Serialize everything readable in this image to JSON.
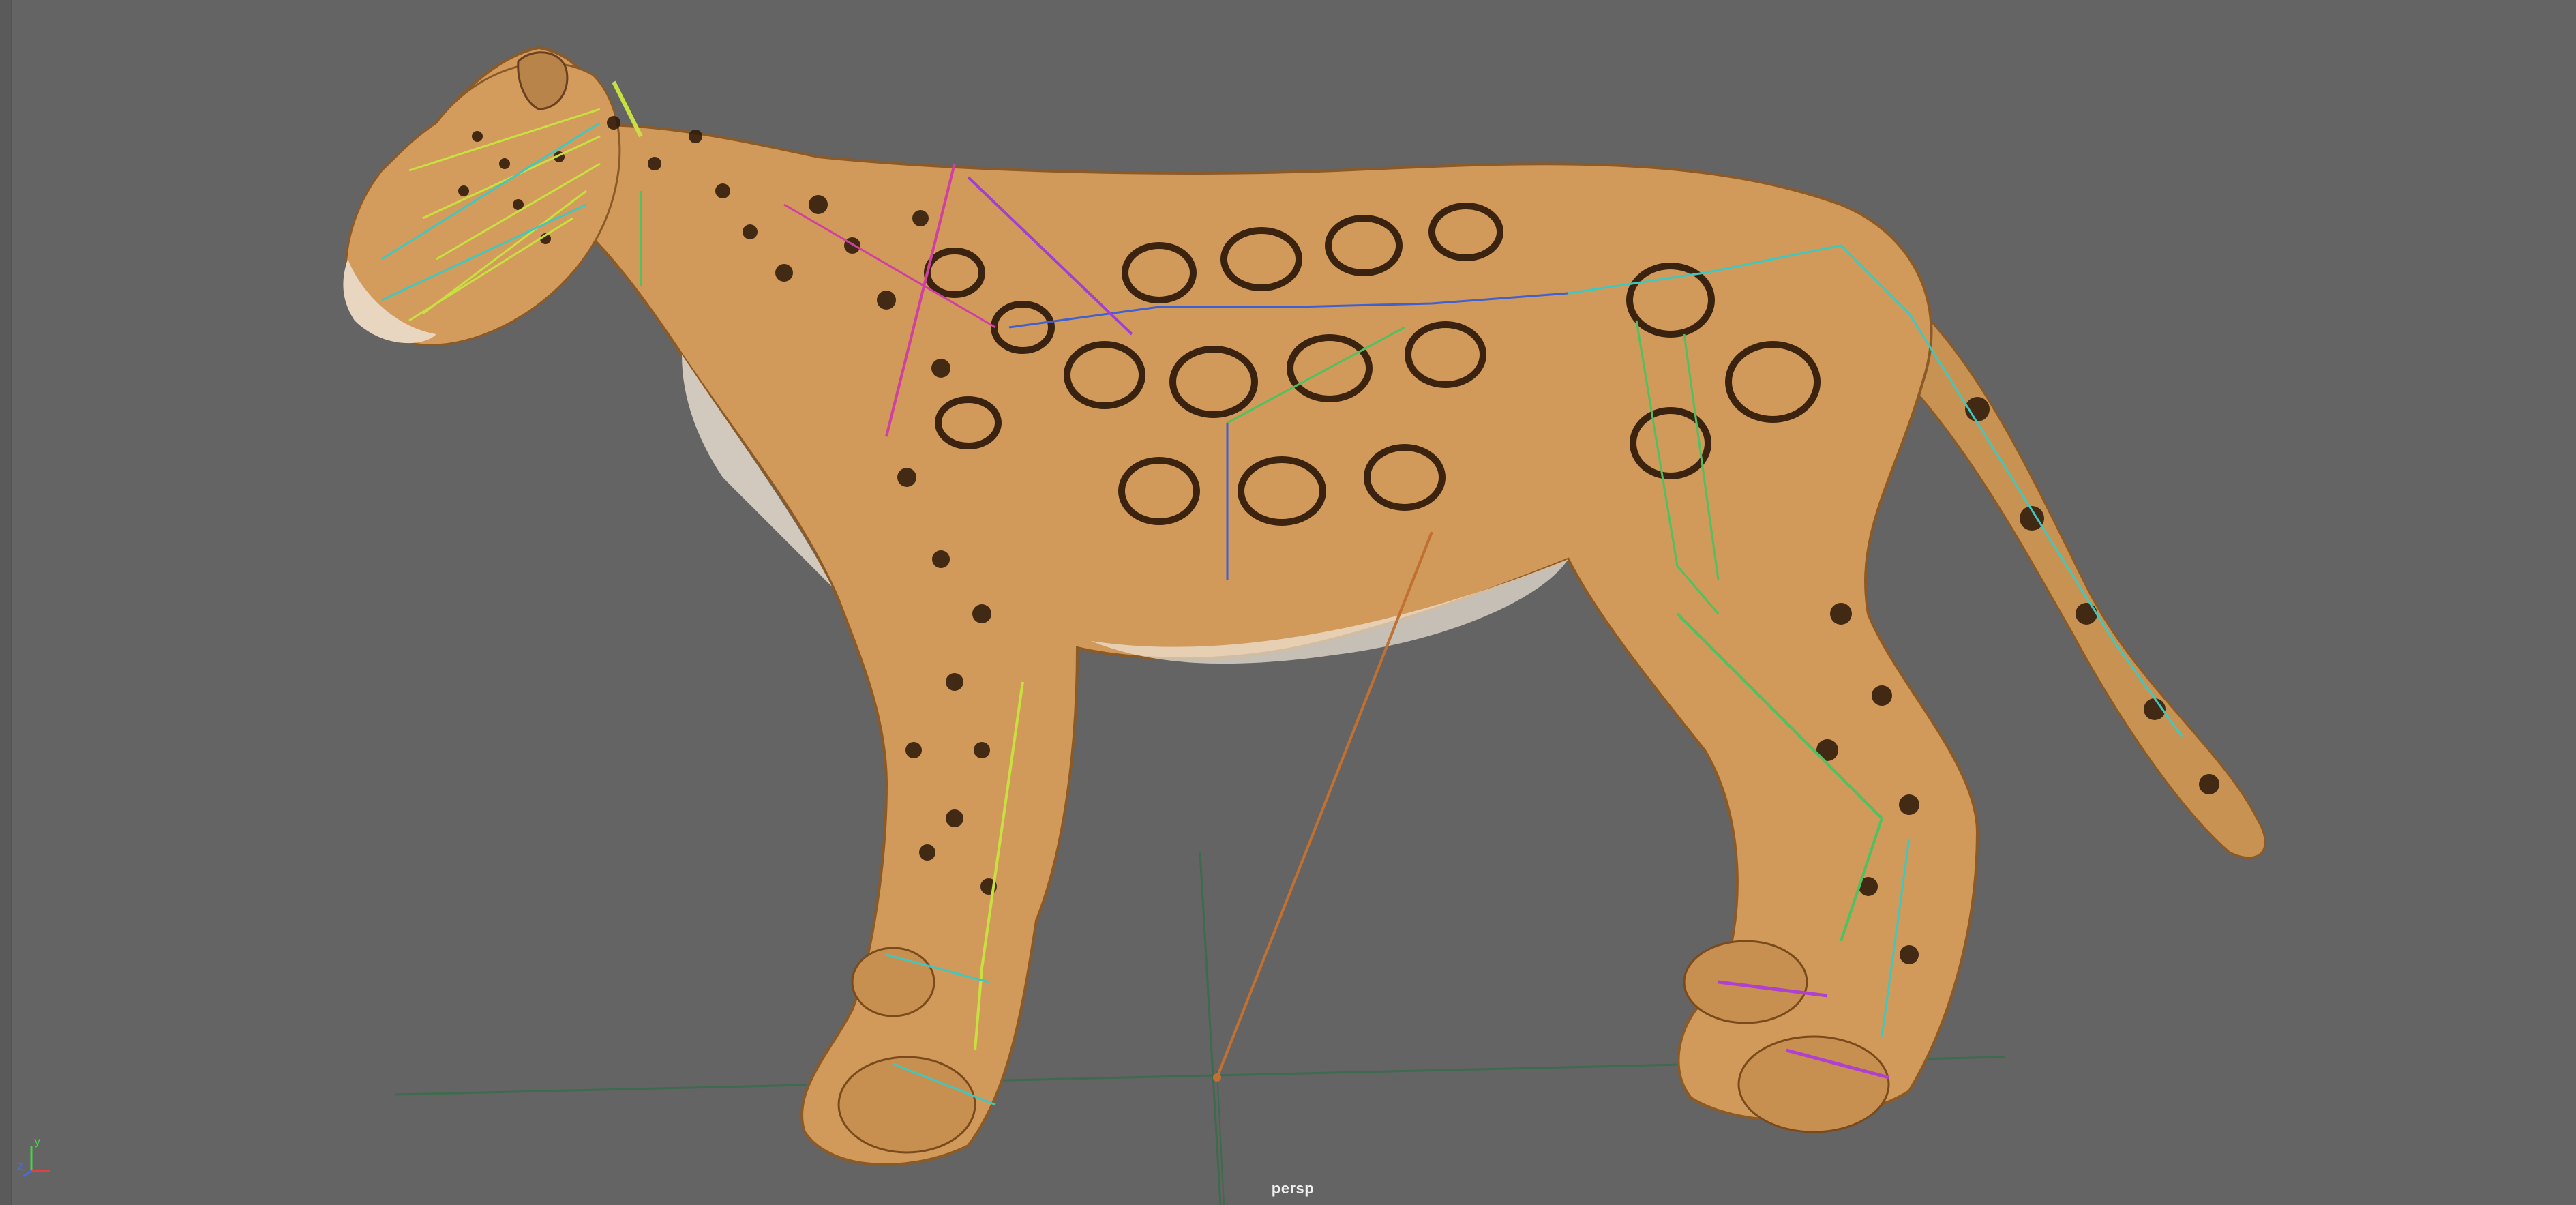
{
  "viewport": {
    "camera_name": "persp",
    "background_color": "#646464"
  },
  "axis_gizmo": {
    "x_label": "x",
    "y_label": "y",
    "z_label": "z",
    "x_color": "#e04040",
    "y_color": "#4ad04a",
    "z_color": "#4a6ae0"
  },
  "scene": {
    "subject": "jaguar-model-with-skeleton-rig",
    "grid_color": "#3e6a4e",
    "bone_colors": [
      "#c8e040",
      "#40c8c0",
      "#d040a0",
      "#4060d0",
      "#50c060",
      "#c07030"
    ]
  }
}
